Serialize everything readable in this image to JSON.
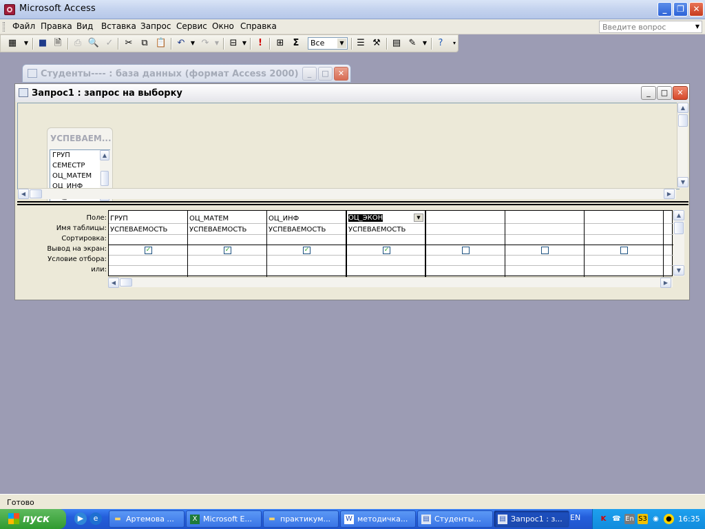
{
  "app": {
    "title": "Microsoft Access"
  },
  "menu": {
    "items": [
      "Файл",
      "Правка",
      "Вид",
      "Вставка",
      "Запрос",
      "Сервис",
      "Окно",
      "Справка"
    ],
    "help_placeholder": "Введите вопрос"
  },
  "toolbar": {
    "top_values_combo": "Все"
  },
  "db_window": {
    "title": "Студенты---- : база данных (формат Access 2000)"
  },
  "query_window": {
    "title": "Запрос1 : запрос на выборку",
    "table": {
      "name": "УСПЕВАЕМ...",
      "fields": [
        "ГРУП",
        "СЕМЕСТР",
        "ОЦ_МАТЕМ",
        "ОЦ_ИНФ",
        "ОЦ_ЭКОН"
      ]
    },
    "grid": {
      "row_labels": [
        "Поле:",
        "Имя таблицы:",
        "Сортировка:",
        "Вывод на экран:",
        "Условие отбора:",
        "или:"
      ],
      "columns": [
        {
          "field": "ГРУП",
          "table": "УСПЕВАЕМОСТЬ",
          "show": true
        },
        {
          "field": "ОЦ_МАТЕМ",
          "table": "УСПЕВАЕМОСТЬ",
          "show": true
        },
        {
          "field": "ОЦ_ИНФ",
          "table": "УСПЕВАЕМОСТЬ",
          "show": true
        },
        {
          "field": "ОЦ_ЭКОН",
          "table": "УСПЕВАЕМОСТЬ",
          "show": true
        },
        {
          "field": "",
          "table": "",
          "show": false
        },
        {
          "field": "",
          "table": "",
          "show": false
        },
        {
          "field": "",
          "table": "",
          "show": false
        }
      ]
    }
  },
  "status": {
    "text": "Готово"
  },
  "taskbar": {
    "start_label": "пуск",
    "tasks": [
      "Артемова ...",
      "Microsoft E...",
      "практикум...",
      "методичка...",
      "Студенты...",
      "Запрос1 : з..."
    ],
    "language": "EN",
    "clock": "16:35"
  },
  "colors": {
    "desktop_mdi": "#9c9cb4",
    "taskbar_blue": "#245edb",
    "start_green": "#2f9a2f"
  }
}
